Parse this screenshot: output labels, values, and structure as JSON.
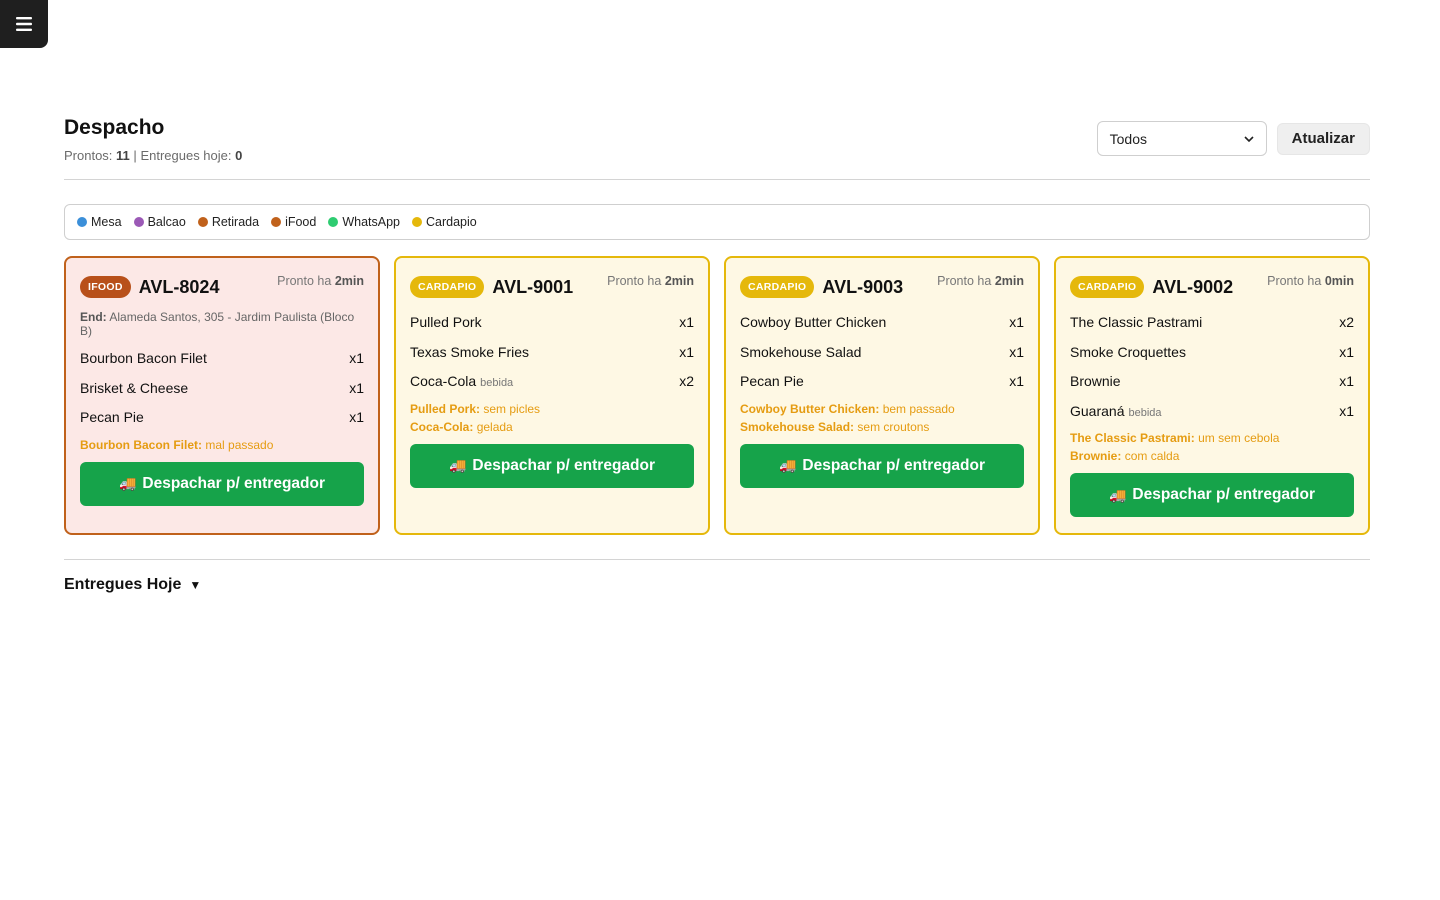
{
  "header": {
    "title": "Despacho",
    "stats": {
      "ready_label": "Prontos:",
      "ready_count": "11",
      "separator": "|",
      "delivered_label": "Entregues hoje:",
      "delivered_count": "0"
    },
    "filter_value": "Todos",
    "refresh_label": "Atualizar"
  },
  "legend": [
    {
      "label": "Mesa",
      "color": "#3b8fd9"
    },
    {
      "label": "Balcao",
      "color": "#9b59b6"
    },
    {
      "label": "Retirada",
      "color": "#c0611b"
    },
    {
      "label": "iFood",
      "color": "#c0611b"
    },
    {
      "label": "WhatsApp",
      "color": "#2ecc71"
    },
    {
      "label": "Cardapio",
      "color": "#e5b80b"
    }
  ],
  "cards": [
    {
      "badge": "IFOOD",
      "id": "AVL-8024",
      "ready_prefix": "Pronto ha",
      "ready_time": "2min",
      "address_label": "End:",
      "address": "Alameda Santos, 305 - Jardim Paulista (Bloco B)",
      "items": [
        {
          "name": "Bourbon Bacon Filet",
          "category": "",
          "qty": "x1"
        },
        {
          "name": "Brisket & Cheese",
          "category": "",
          "qty": "x1"
        },
        {
          "name": "Pecan Pie",
          "category": "",
          "qty": "x1"
        }
      ],
      "notes": [
        {
          "item": "Bourbon Bacon Filet:",
          "text": "mal passado"
        }
      ],
      "button": "Despachar p/ entregador"
    },
    {
      "badge": "CARDAPIO",
      "id": "AVL-9001",
      "ready_prefix": "Pronto ha",
      "ready_time": "2min",
      "items": [
        {
          "name": "Pulled Pork",
          "category": "",
          "qty": "x1"
        },
        {
          "name": "Texas Smoke Fries",
          "category": "",
          "qty": "x1"
        },
        {
          "name": "Coca-Cola",
          "category": "bebida",
          "qty": "x2"
        }
      ],
      "notes": [
        {
          "item": "Pulled Pork:",
          "text": "sem picles"
        },
        {
          "item": "Coca-Cola:",
          "text": "gelada"
        }
      ],
      "button": "Despachar p/ entregador"
    },
    {
      "badge": "CARDAPIO",
      "id": "AVL-9003",
      "ready_prefix": "Pronto ha",
      "ready_time": "2min",
      "items": [
        {
          "name": "Cowboy Butter Chicken",
          "category": "",
          "qty": "x1"
        },
        {
          "name": "Smokehouse Salad",
          "category": "",
          "qty": "x1"
        },
        {
          "name": "Pecan Pie",
          "category": "",
          "qty": "x1"
        }
      ],
      "notes": [
        {
          "item": "Cowboy Butter Chicken:",
          "text": "bem passado"
        },
        {
          "item": "Smokehouse Salad:",
          "text": "sem croutons"
        }
      ],
      "button": "Despachar p/ entregador"
    },
    {
      "badge": "CARDAPIO",
      "id": "AVL-9002",
      "ready_prefix": "Pronto ha",
      "ready_time": "0min",
      "items": [
        {
          "name": "The Classic Pastrami",
          "category": "",
          "qty": "x2"
        },
        {
          "name": "Smoke Croquettes",
          "category": "",
          "qty": "x1"
        },
        {
          "name": "Brownie",
          "category": "",
          "qty": "x1"
        },
        {
          "name": "Guaraná",
          "category": "bebida",
          "qty": "x1"
        }
      ],
      "notes": [
        {
          "item": "The Classic Pastrami:",
          "text": "um sem cebola"
        },
        {
          "item": "Brownie:",
          "text": "com calda"
        }
      ],
      "button": "Despachar p/ entregador"
    }
  ],
  "delivered_section": {
    "title": "Entregues Hoje",
    "arrow": "▼"
  },
  "colors": {
    "ifood_bg": "#fce8e6",
    "ifood_border": "#c0611b",
    "ifood_badge": "#b8501a",
    "cardapio_bg": "#fef8e4",
    "cardapio_border": "#e5b80b",
    "cardapio_badge": "#e5b80b",
    "dispatch_button": "#16a34a",
    "note_color": "#e59c12"
  }
}
